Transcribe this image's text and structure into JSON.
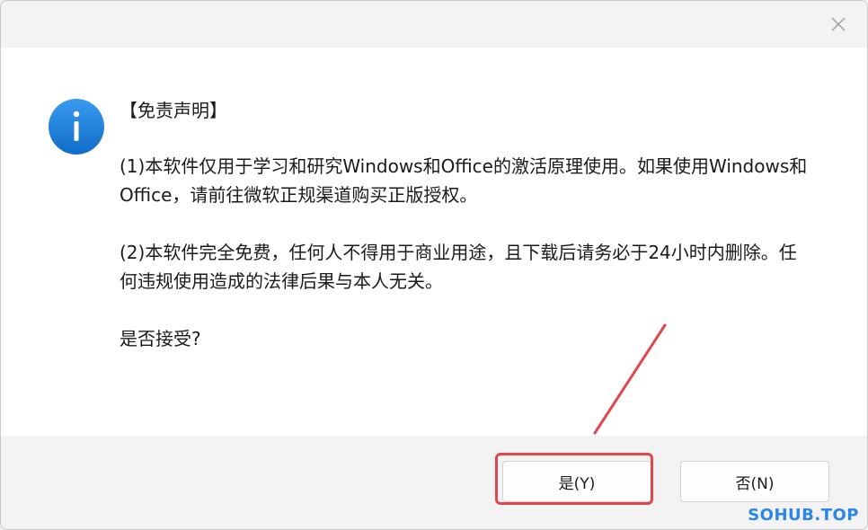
{
  "dialog": {
    "heading": "【免责声明】",
    "para1": "(1)本软件仅用于学习和研究Windows和Office的激活原理使用。如果使用Windows和Office，请前往微软正规渠道购买正版授权。",
    "para2": "(2)本软件完全免费，任何人不得用于商业用途，且下载后请务必于24小时内删除。任何违规使用造成的法律后果与本人无关。",
    "question": "是否接受?"
  },
  "buttons": {
    "yes_label": "是(Y)",
    "no_label": "否(N)"
  },
  "icons": {
    "info": "info-icon",
    "close": "close-icon"
  },
  "colors": {
    "info_blue": "#1e7fd8",
    "highlight_red": "#e0474c"
  },
  "watermark": "SOHUB.TOP"
}
